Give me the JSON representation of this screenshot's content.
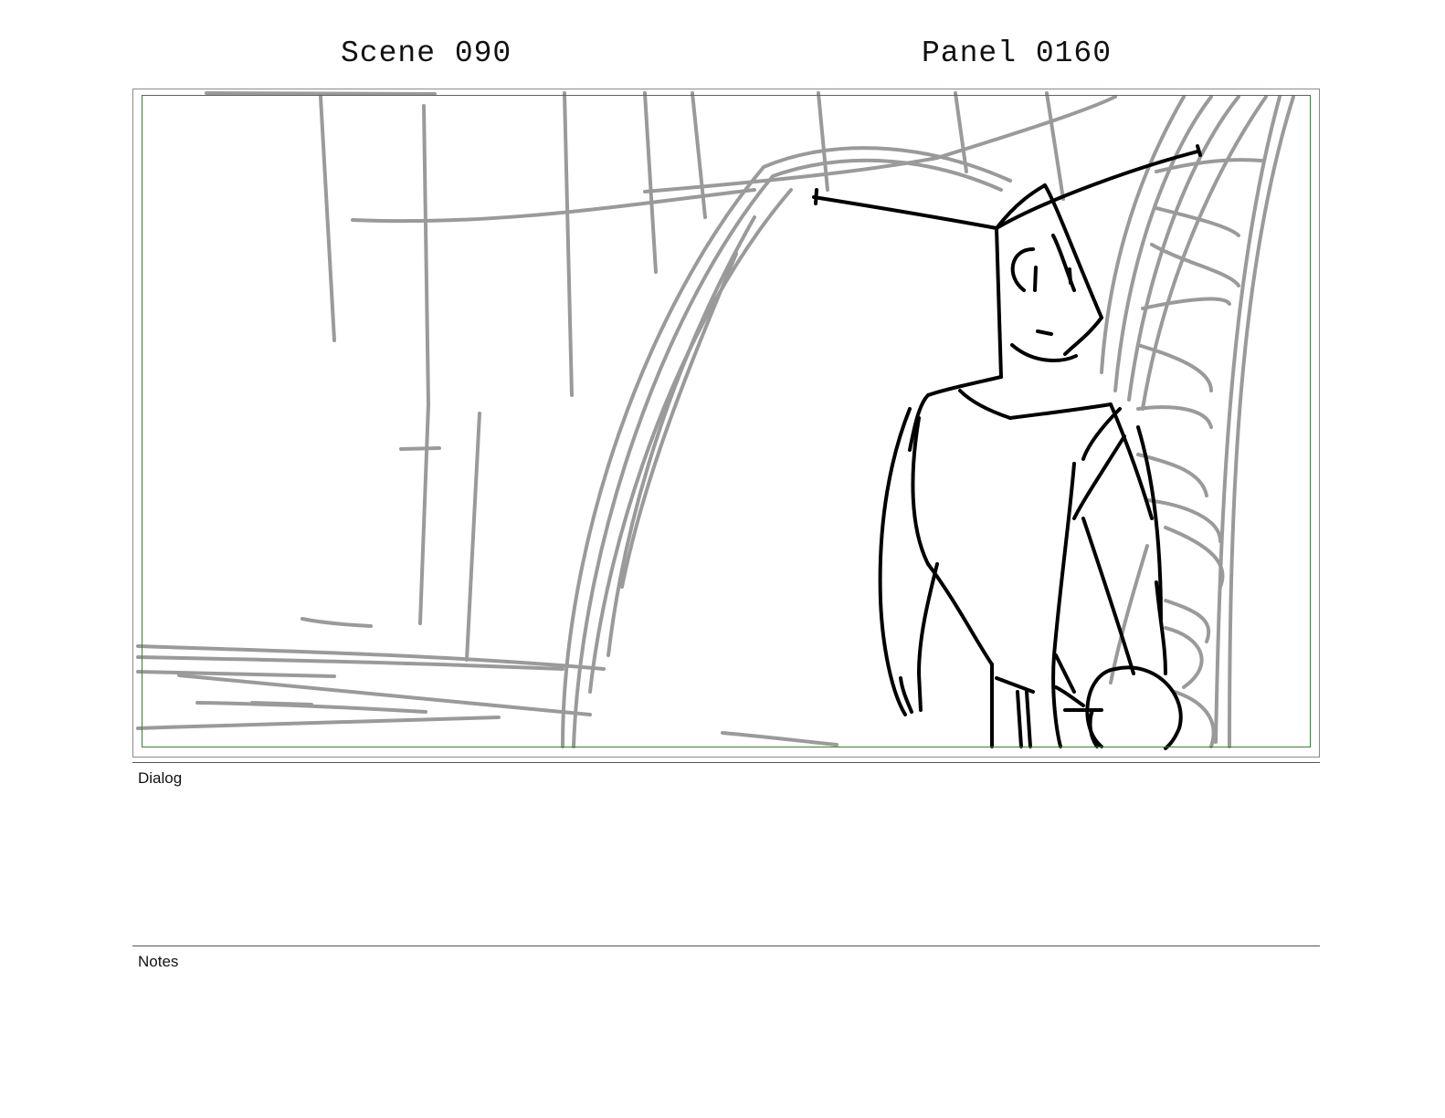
{
  "header": {
    "scene": "Scene 090",
    "panel": "Panel 0160"
  },
  "panel_image": {
    "description_icon": "storyboard-sketch",
    "colors": {
      "background_lines": "#9a9a9a",
      "character_lines": "#000000",
      "safe_frame": "#3a7a3a"
    }
  },
  "sections": {
    "dialog_label": "Dialog",
    "dialog_text": "",
    "notes_label": "Notes",
    "notes_text": ""
  }
}
